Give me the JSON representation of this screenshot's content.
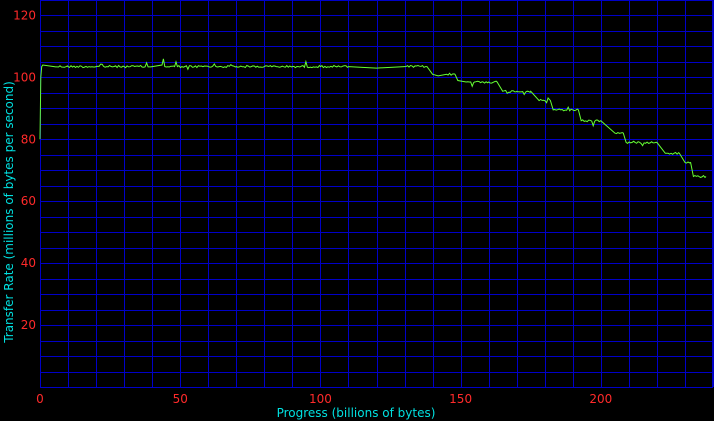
{
  "chart_data": {
    "type": "line",
    "xlabel": "Progress (billions of bytes)",
    "ylabel": "Transfer Rate (millions of bytes per second)",
    "xlim": [
      0,
      240
    ],
    "ylim": [
      0,
      125
    ],
    "x_ticks": [
      0,
      50,
      100,
      150,
      200
    ],
    "y_ticks": [
      20,
      40,
      60,
      80,
      100,
      120
    ],
    "x_minor_step": 10,
    "y_minor_step": 5,
    "grid": true,
    "colors": {
      "background": "#000000",
      "grid": "#0000c8",
      "line": "#66ff33",
      "tick_labels": "#ff2a2a",
      "axis_labels": "#00e0e0"
    },
    "series": [
      {
        "x": [
          0,
          0.3,
          0.6,
          1,
          5,
          10,
          20,
          30,
          40,
          43.5,
          44,
          44.5,
          48,
          48.5,
          49,
          60,
          70,
          80,
          90,
          100,
          110,
          120,
          130,
          138,
          140,
          142,
          145,
          148,
          149,
          152,
          155,
          158,
          160,
          163,
          165,
          170,
          175,
          178,
          182,
          183,
          190,
          192,
          193,
          200,
          205,
          208,
          209,
          220,
          223,
          224,
          228,
          230,
          232,
          233,
          235,
          237.5
        ],
        "y": [
          80,
          100,
          103.5,
          104,
          103.5,
          103.5,
          103.5,
          103.5,
          103.5,
          104,
          106,
          103.5,
          103.5,
          105,
          103.5,
          103.5,
          103.5,
          103.5,
          103.5,
          103.5,
          103.5,
          103,
          103.5,
          103.5,
          101,
          100.5,
          101,
          101,
          99,
          98.5,
          98.5,
          98.5,
          98.5,
          98.5,
          95.5,
          95.5,
          95.5,
          92.5,
          92.5,
          89.5,
          89.5,
          89.5,
          86,
          86,
          82,
          82,
          79,
          79,
          75.5,
          75.5,
          75.5,
          72.5,
          72.5,
          68,
          68,
          68
        ]
      }
    ]
  }
}
